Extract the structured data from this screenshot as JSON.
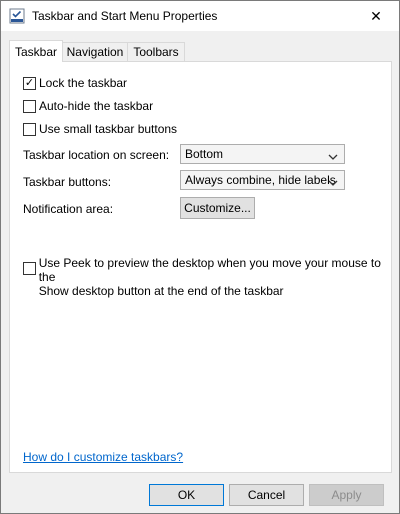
{
  "window": {
    "title": "Taskbar and Start Menu Properties",
    "close_glyph": "✕"
  },
  "tabs": [
    {
      "label": "Taskbar",
      "active": true
    },
    {
      "label": "Navigation",
      "active": false
    },
    {
      "label": "Toolbars",
      "active": false
    }
  ],
  "options": {
    "lock": {
      "label": "Lock the taskbar",
      "checked": true
    },
    "autohide": {
      "label": "Auto-hide the taskbar",
      "checked": false
    },
    "small": {
      "label": "Use small taskbar buttons",
      "checked": false
    },
    "peek": {
      "label_line1": "Use Peek to preview the desktop when you move your mouse to the",
      "label_line2": "Show desktop button at the end of the taskbar",
      "checked": false
    }
  },
  "location": {
    "label": "Taskbar location on screen:",
    "value": "Bottom"
  },
  "buttons_setting": {
    "label": "Taskbar buttons:",
    "value": "Always combine, hide labels"
  },
  "notification": {
    "label": "Notification area:",
    "button": "Customize..."
  },
  "help_link": "How do I customize taskbars?",
  "footer": {
    "ok": "OK",
    "cancel": "Cancel",
    "apply": "Apply"
  },
  "icons": {
    "check": "✓",
    "dropdown": "chevron-down"
  },
  "colors": {
    "accent": "#0078d7",
    "link": "#0066cc"
  }
}
